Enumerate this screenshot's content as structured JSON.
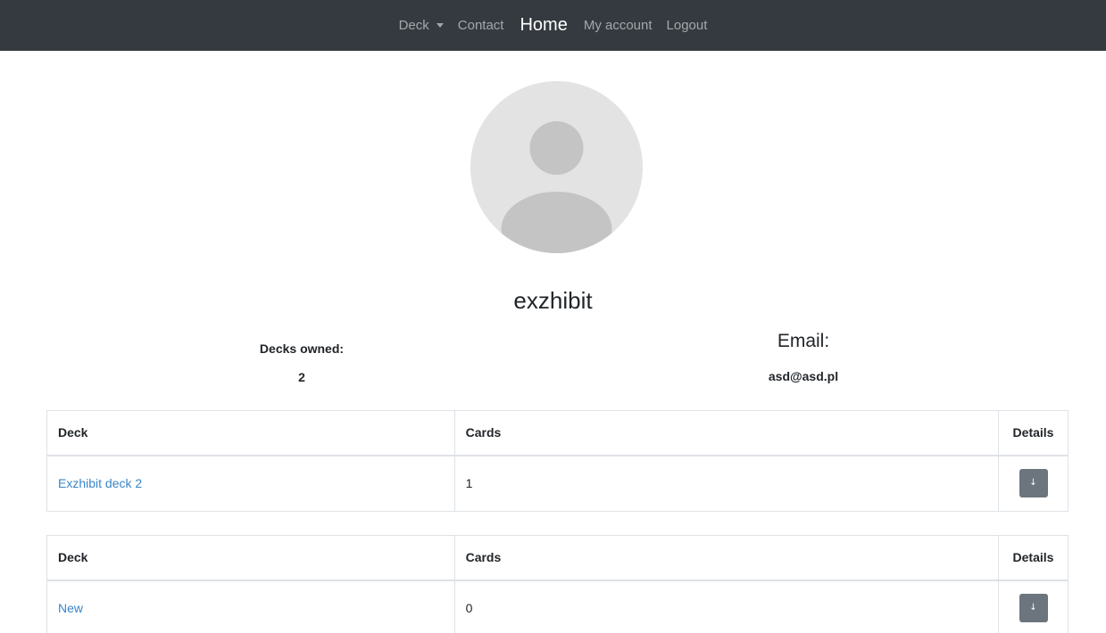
{
  "nav": {
    "items": [
      {
        "label": "Deck",
        "dropdown": true,
        "active": false
      },
      {
        "label": "Contact",
        "active": false
      },
      {
        "label": "Home",
        "active": true
      },
      {
        "label": "My account",
        "active": false
      },
      {
        "label": "Logout",
        "active": false
      }
    ]
  },
  "profile": {
    "username": "exzhibit",
    "decks_owned_label": "Decks owned:",
    "decks_owned_value": "2",
    "email_label": "Email:",
    "email_value": "asd@asd.pl"
  },
  "tables": [
    {
      "headers": {
        "deck": "Deck",
        "cards": "Cards",
        "details": "Details"
      },
      "rows": [
        {
          "deck": "Exzhibit deck 2",
          "cards": "1",
          "details_icon": "↓"
        }
      ]
    },
    {
      "headers": {
        "deck": "Deck",
        "cards": "Cards",
        "details": "Details"
      },
      "rows": [
        {
          "deck": "New",
          "cards": "0",
          "details_icon": "↓"
        }
      ]
    }
  ],
  "colors": {
    "navbar": "#343a40",
    "link": "#3a86c8",
    "button": "#6c757d",
    "avatar_bg": "#e3e3e3",
    "avatar_figure": "#c4c4c4"
  }
}
